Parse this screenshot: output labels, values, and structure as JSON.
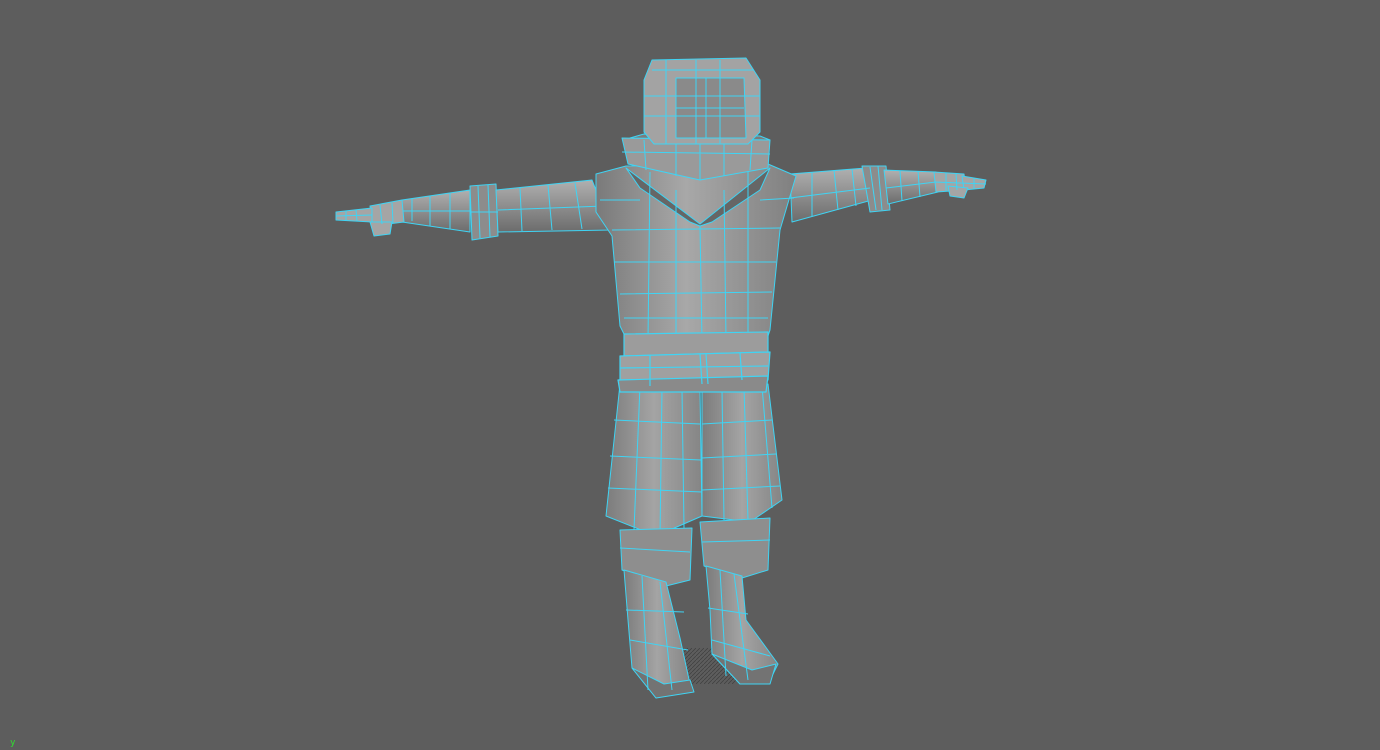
{
  "viewport": {
    "background": "#5d5d5d",
    "mode": "wireframe-on-shaded",
    "wire_color": "#3fd4f4",
    "shade_light": "#a6a6a6",
    "shade_mid": "#8a8a8a",
    "shade_dark": "#6e6e6e",
    "shadow_color": "#2a2a2a"
  },
  "model": {
    "pose": "T-pose",
    "parts": [
      "helmet",
      "collar",
      "torso",
      "left-arm",
      "right-arm",
      "left-hand",
      "right-hand",
      "belt",
      "left-leg",
      "right-leg",
      "left-boot",
      "right-boot"
    ]
  },
  "axis": {
    "label": "y",
    "color": "#30e030"
  }
}
